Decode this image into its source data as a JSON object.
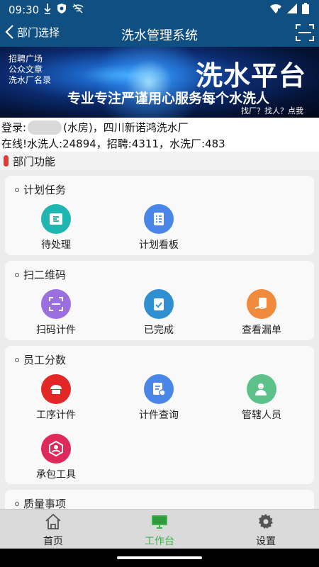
{
  "status": {
    "time": "09:30"
  },
  "appbar": {
    "back_label": "部门选择",
    "title": "洗水管理系统"
  },
  "banner": {
    "links": [
      "招聘广场",
      "公众文章",
      "洗水厂名录"
    ],
    "headline": "洗水平台",
    "slogan": "专业专注严谨用心服务每个水洗人",
    "sub": "找厂？找人？点我"
  },
  "info": {
    "login_prefix": "登录:",
    "login_suffix": "(水房)，四川新诺鸿洗水厂",
    "online": "在线!水洗人:24894，招聘:4311，水洗厂:483"
  },
  "section": {
    "title": "部门功能"
  },
  "cards": [
    {
      "title": "计划任务",
      "items": [
        {
          "label": "待处理",
          "icon": "pending-icon",
          "color": "#1fb5b0"
        },
        {
          "label": "计划看板",
          "icon": "plan-board-icon",
          "color": "#4a86e8"
        }
      ]
    },
    {
      "title": "扫二维码",
      "items": [
        {
          "label": "扫码计件",
          "icon": "scan-count-icon",
          "color": "#9b6fe0"
        },
        {
          "label": "已完成",
          "icon": "completed-icon",
          "color": "#2f8fd0"
        },
        {
          "label": "查看漏单",
          "icon": "missing-order-icon",
          "color": "#f08a3c"
        }
      ]
    },
    {
      "title": "员工分数",
      "items": [
        {
          "label": "工序计件",
          "icon": "process-count-icon",
          "color": "#e32626"
        },
        {
          "label": "计件查询",
          "icon": "count-query-icon",
          "color": "#4a86e8"
        },
        {
          "label": "管辖人员",
          "icon": "staff-icon",
          "color": "#5cc28a"
        },
        {
          "label": "承包工具",
          "icon": "contract-tool-icon",
          "color": "#e0295b"
        }
      ]
    },
    {
      "title": "质量事项",
      "items": []
    }
  ],
  "nav": [
    {
      "label": "首页",
      "icon": "home-icon",
      "active": false
    },
    {
      "label": "工作台",
      "icon": "workbench-icon",
      "active": true
    },
    {
      "label": "设置",
      "icon": "gear-icon",
      "active": false
    }
  ],
  "colors": {
    "primary": "#0f4f82",
    "accent_active": "#3bb24b"
  }
}
